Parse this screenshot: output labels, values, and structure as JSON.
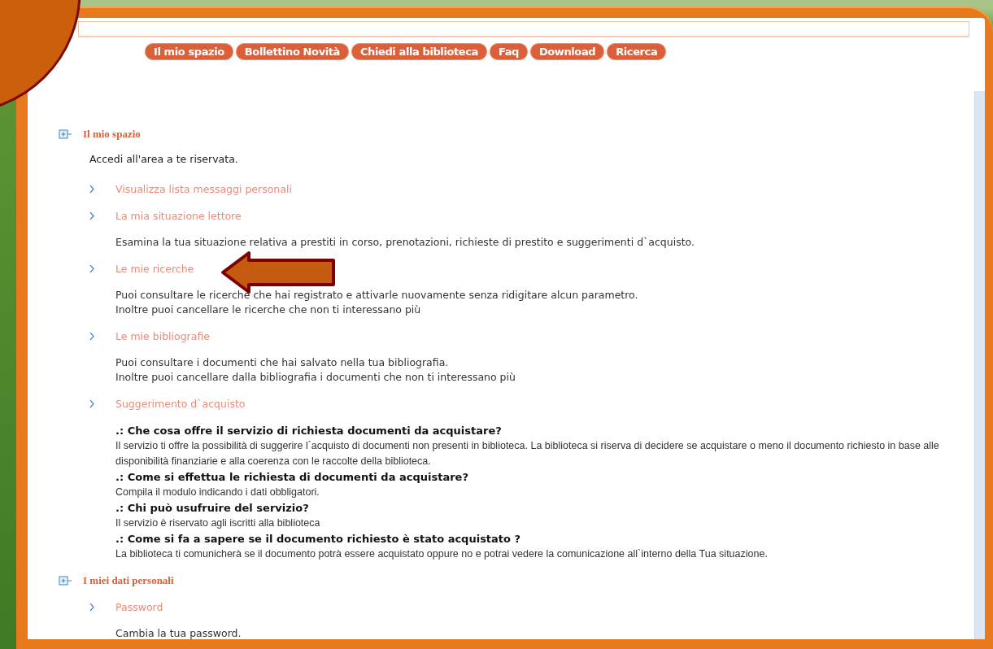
{
  "nav": [
    "Il mio spazio",
    "Bollettino Novità",
    "Chiedi alla biblioteca",
    "Faq",
    "Download",
    "Ricerca"
  ],
  "sections": [
    {
      "title": "Il mio spazio",
      "description": "Accedi all'area a te riservata.",
      "items": [
        {
          "label": "Visualizza lista messaggi personali"
        },
        {
          "label": "La mia situazione lettore",
          "details": [
            {
              "kind": "text",
              "text": "Esamina la tua situazione relativa a prestiti in corso, prenotazioni, richieste di prestito e suggerimenti d`acquisto."
            }
          ]
        },
        {
          "label": "Le mie ricerche",
          "details": [
            {
              "kind": "text",
              "text": "Puoi consultare le ricerche che hai registrato e attivarle nuovamente senza ridigitare alcun parametro."
            },
            {
              "kind": "text",
              "text": "Inoltre puoi cancellare le ricerche che non ti interessano più"
            }
          ]
        },
        {
          "label": "Le mie bibliografie",
          "details": [
            {
              "kind": "text",
              "text": "Puoi consultare i documenti che hai salvato nella tua bibliografia."
            },
            {
              "kind": "text",
              "text": "Inoltre puoi cancellare dalla bibliografia i documenti che non ti interessano più"
            }
          ]
        },
        {
          "label": "Suggerimento d`acquisto",
          "details": [
            {
              "kind": "question",
              "text": ".: Che cosa offre il servizio di richiesta documenti da acquistare?"
            },
            {
              "kind": "answer",
              "text": "Il servizio ti offre la possibilità di suggerire l`acquisto di documenti non presenti in biblioteca. La biblioteca si riserva di decidere se acquistare o meno il documento richiesto in base alle disponibilità finanziarie e alla coerenza con le raccolte della biblioteca."
            },
            {
              "kind": "question",
              "text": ".: Come si effettua le richiesta di documenti da acquistare?"
            },
            {
              "kind": "answer",
              "text": "Compila il modulo indicando i dati obbligatori."
            },
            {
              "kind": "question",
              "text": ".: Chi può usufruire del servizio?"
            },
            {
              "kind": "answer",
              "text": "Il servizio è riservato agli iscritti alla biblioteca"
            },
            {
              "kind": "question",
              "text": ".: Come si fa a sapere se il documento richiesto è stato acquistato ?"
            },
            {
              "kind": "answer",
              "text": "La biblioteca ti comunicherà se il documento potrà essere acquistato oppure no e potrai vedere la comunicazione all`interno della Tua situazione."
            }
          ]
        }
      ]
    },
    {
      "title": "I miei dati personali",
      "items": [
        {
          "label": "Password",
          "details": [
            {
              "kind": "text",
              "text": "Cambia la tua password."
            }
          ]
        }
      ]
    }
  ]
}
